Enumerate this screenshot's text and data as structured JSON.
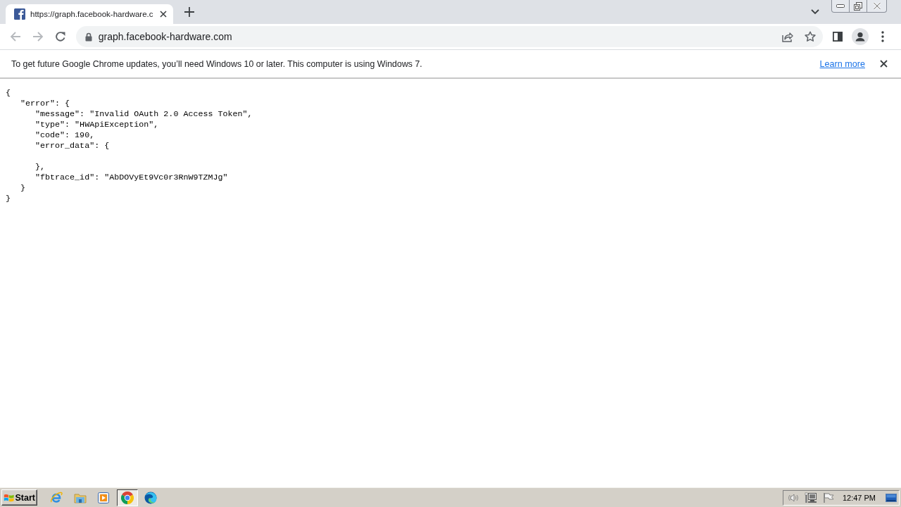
{
  "browser": {
    "tabs": [
      {
        "title": "https://graph.facebook-hardware.c",
        "selected": true
      }
    ],
    "toolbar": {
      "nav_buttons": [
        {
          "kind": "back",
          "disabled": true
        },
        {
          "kind": "forward",
          "disabled": true
        },
        {
          "kind": "reload",
          "disabled": false
        }
      ],
      "url": "graph.facebook-hardware.com"
    },
    "infobar": {
      "message": "To get future Google Chrome updates, you’ll need Windows 10 or later. This computer is using Windows 7.",
      "link": "Learn more"
    }
  },
  "page": {
    "json_view": [
      {
        "kind": "block",
        "open": "{",
        "close": "}",
        "children": [
          {
            "kind": "block",
            "open": "\"error\": {",
            "close": "}",
            "children": [
              {
                "kind": "line",
                "text": "\"message\": \"Invalid OAuth 2.0 Access Token\","
              },
              {
                "kind": "line",
                "text": "\"type\": \"HWApiException\","
              },
              {
                "kind": "line",
                "text": "\"code\": 190,"
              },
              {
                "kind": "block",
                "open": "\"error_data\": {",
                "close": "},"
              },
              {
                "kind": "line",
                "text": "\"fbtrace_id\": \"AbDOVyEt9Vc0r3RnW9TZMJg\""
              }
            ]
          }
        ]
      }
    ]
  },
  "taskbar": {
    "start_label": "Start",
    "apps": [
      {
        "kind": "ie",
        "selected": false
      },
      {
        "kind": "folder",
        "selected": false
      },
      {
        "kind": "player",
        "selected": false
      },
      {
        "kind": "chrome",
        "selected": true
      },
      {
        "kind": "edge",
        "selected": false
      }
    ],
    "clock": "12:47 PM"
  }
}
